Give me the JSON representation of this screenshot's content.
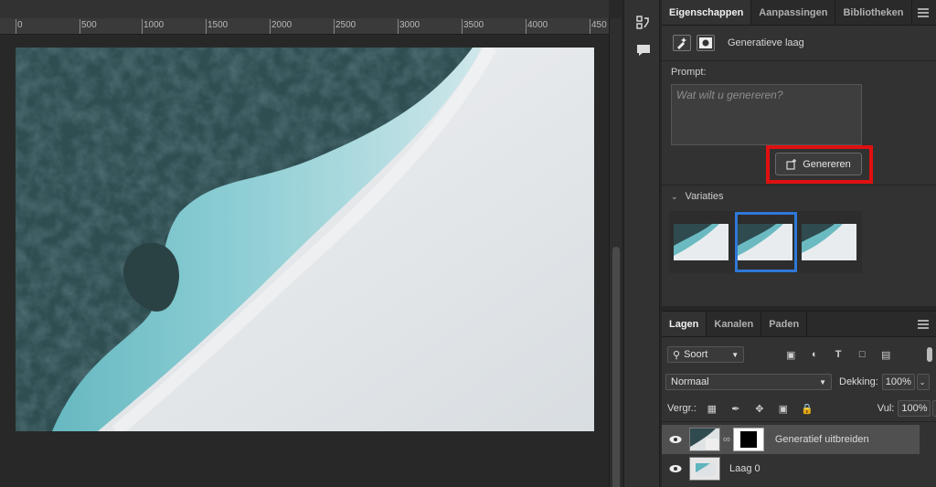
{
  "ruler": {
    "labels": [
      "0",
      "500",
      "1000",
      "1500",
      "2000",
      "2500",
      "3000",
      "3500",
      "4000",
      "450"
    ]
  },
  "properties": {
    "tabs": [
      "Eigenschappen",
      "Aanpassingen",
      "Bibliotheken"
    ],
    "layer_type_label": "Generatieve laag",
    "prompt_label": "Prompt:",
    "prompt_placeholder": "Wat wilt u genereren?",
    "generate_button": "Genereren",
    "variations_label": "Variaties"
  },
  "layers_panel": {
    "tabs": [
      "Lagen",
      "Kanalen",
      "Paden"
    ],
    "filter_label": "Soort",
    "blend_mode": "Normaal",
    "opacity_label": "Dekking:",
    "opacity_value": "100%",
    "lock_label": "Vergr.:",
    "fill_label": "Vul:",
    "fill_value": "100%",
    "layers": [
      {
        "name": "Generatief uitbreiden"
      },
      {
        "name": "Laag 0"
      }
    ]
  },
  "colors": {
    "highlight_red": "#e01010",
    "selection_blue": "#2f78d8",
    "panel_bg": "#323232"
  },
  "icons": [
    "generative-layer-icon",
    "mask-icon",
    "history-icon",
    "comment-icon",
    "generate-icon",
    "eye-icon",
    "link-icon",
    "menu-icon"
  ]
}
